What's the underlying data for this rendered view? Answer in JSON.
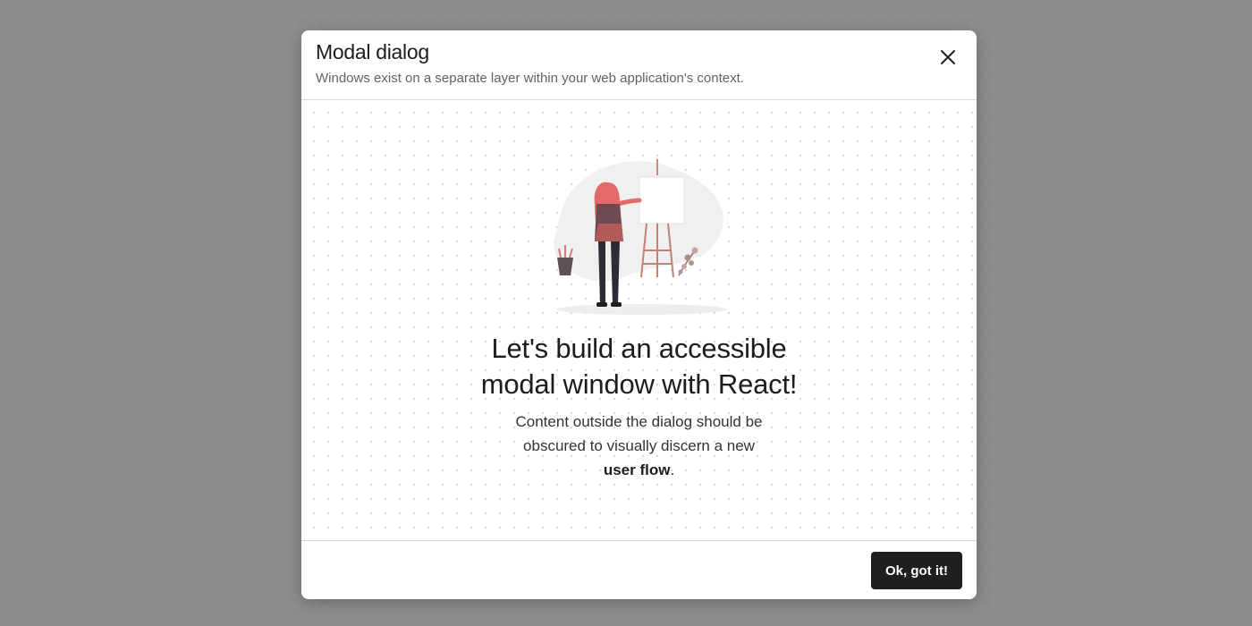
{
  "modal": {
    "title": "Modal dialog",
    "subtitle": "Windows exist on a separate layer within your web application's context.",
    "close_icon": "close-icon",
    "headline_line1": "Let's build an accessible",
    "headline_line2": "modal window with React!",
    "description_line1": "Content outside the dialog should be",
    "description_line2": "obscured to visually discern a new",
    "description_bold": "user flow",
    "description_end": ".",
    "confirm_label": "Ok, got it!",
    "illustration_icon": "painter-at-easel-illustration"
  },
  "colors": {
    "overlay": "#8d8d8d",
    "modal_bg": "#ffffff",
    "accent": "#e46a6a",
    "button_bg": "#1f1f1f",
    "button_text": "#ffffff"
  }
}
